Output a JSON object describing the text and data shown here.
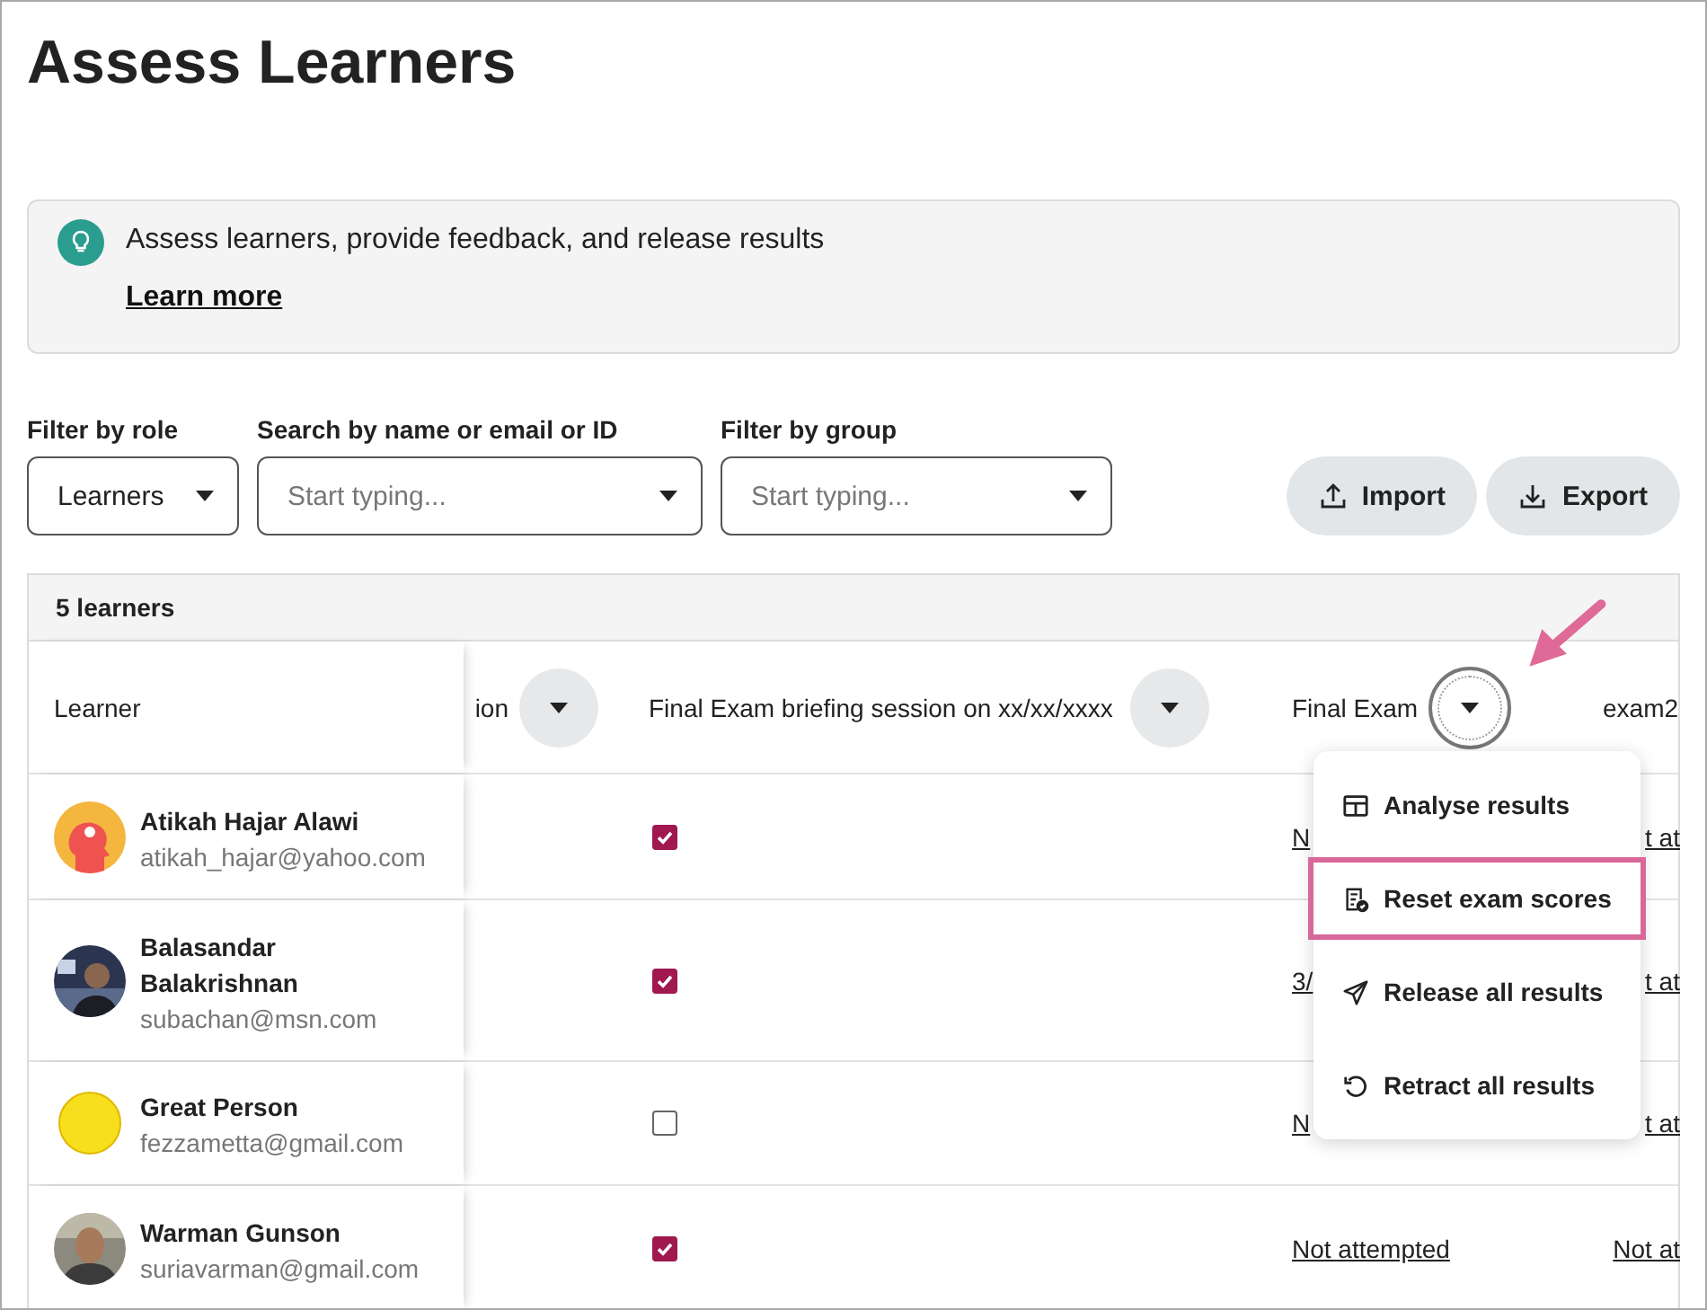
{
  "title": "Assess Learners",
  "info": {
    "text": "Assess learners, provide feedback, and release results",
    "link": "Learn more"
  },
  "filters": [
    {
      "label": "Filter by role",
      "value": "Learners"
    },
    {
      "label": "Search by name or email or ID",
      "placeholder": "Start typing..."
    },
    {
      "label": "Filter by group",
      "placeholder": "Start typing..."
    }
  ],
  "buttons": [
    {
      "label": "Import"
    },
    {
      "label": "Export"
    }
  ],
  "table": {
    "count": "5 learners",
    "columns": [
      {
        "label": "Learner"
      },
      {
        "label": "ion",
        "menu_button": {
          "focused": false
        }
      },
      {
        "label": "Final Exam briefing session on xx/xx/xxxx",
        "menu_button": {
          "focused": false
        }
      },
      {
        "label": "Final Exam",
        "menu_button": {
          "focused": true
        }
      },
      {
        "label": "exam2"
      }
    ],
    "rows": [
      {
        "name": "Atikah Hajar Alawi",
        "email": "atikah_hajar@yahoo.com",
        "checked": true,
        "final_exam": "N",
        "exam2": "t at"
      },
      {
        "name": "Balasandar Balakrishnan",
        "email": "subachan@msn.com",
        "checked": true,
        "final_exam": "3/",
        "exam2": "t at"
      },
      {
        "name": "Great Person",
        "email": "fezzametta@gmail.com",
        "checked": false,
        "final_exam": "N",
        "exam2": "t at"
      },
      {
        "name": "Warman Gunson",
        "email": "suriavarman@gmail.com",
        "checked": true,
        "final_exam": "Not attempted",
        "exam2": "Not at"
      }
    ]
  },
  "menu": {
    "items": [
      {
        "label": "Analyse results",
        "highlighted": false
      },
      {
        "label": "Reset exam scores",
        "highlighted": true
      },
      {
        "label": "Release all results",
        "highlighted": false
      },
      {
        "label": "Retract all results",
        "highlighted": false
      }
    ]
  }
}
